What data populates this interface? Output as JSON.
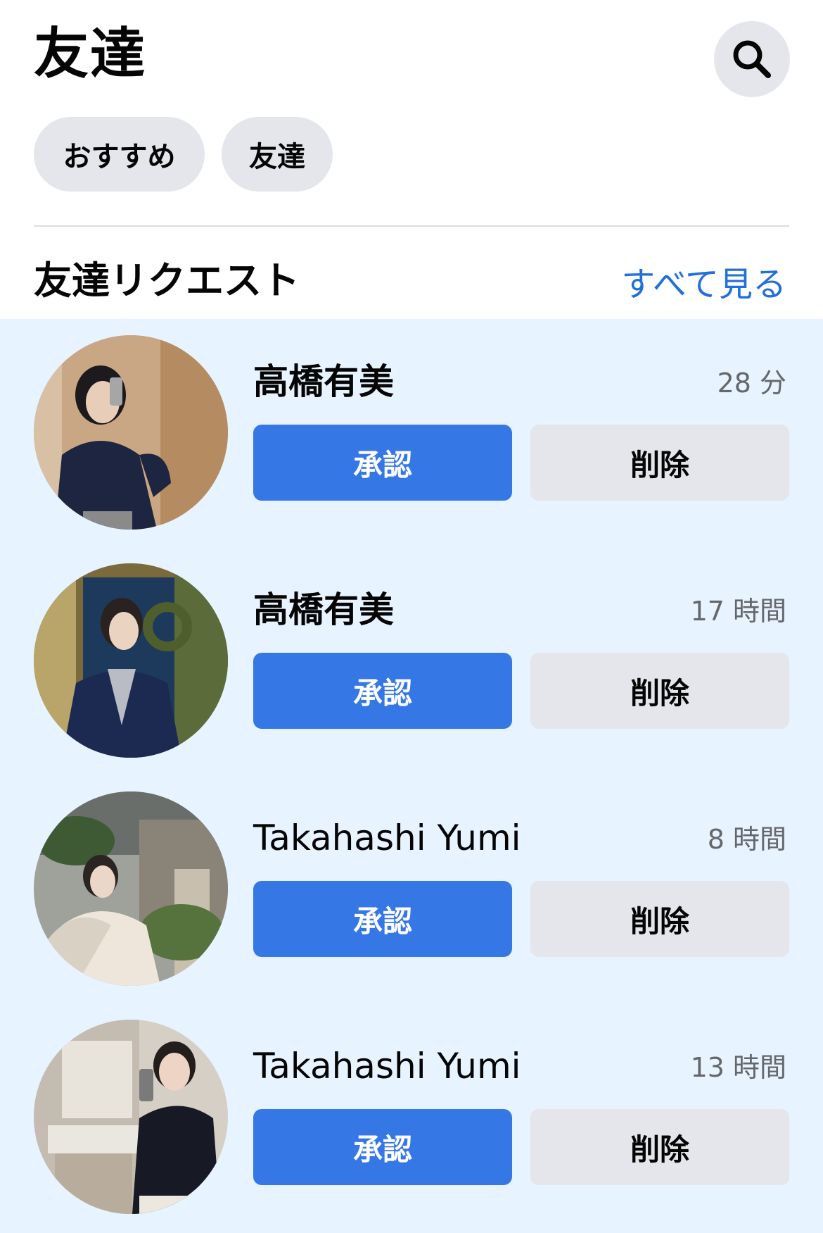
{
  "header": {
    "title": "友達",
    "search_icon": "search-icon"
  },
  "chips": {
    "recommend": "おすすめ",
    "friends": "友達"
  },
  "section": {
    "title": "友達リクエスト",
    "see_all": "すべて見る"
  },
  "colors": {
    "accent": "#3578e5",
    "link": "#216fdb",
    "highlight_bg": "#e7f3ff",
    "button_gray": "#e4e6eb"
  },
  "requests": [
    {
      "name": "高橋有美",
      "time": "28 分",
      "accept_label": "承認",
      "delete_label": "削除"
    },
    {
      "name": "高橋有美",
      "time": "17 時間",
      "accept_label": "承認",
      "delete_label": "削除"
    },
    {
      "name": "Takahashi Yumi",
      "time": "8 時間",
      "accept_label": "承認",
      "delete_label": "削除"
    },
    {
      "name": "Takahashi Yumi",
      "time": "13 時間",
      "accept_label": "承認",
      "delete_label": "削除"
    }
  ]
}
